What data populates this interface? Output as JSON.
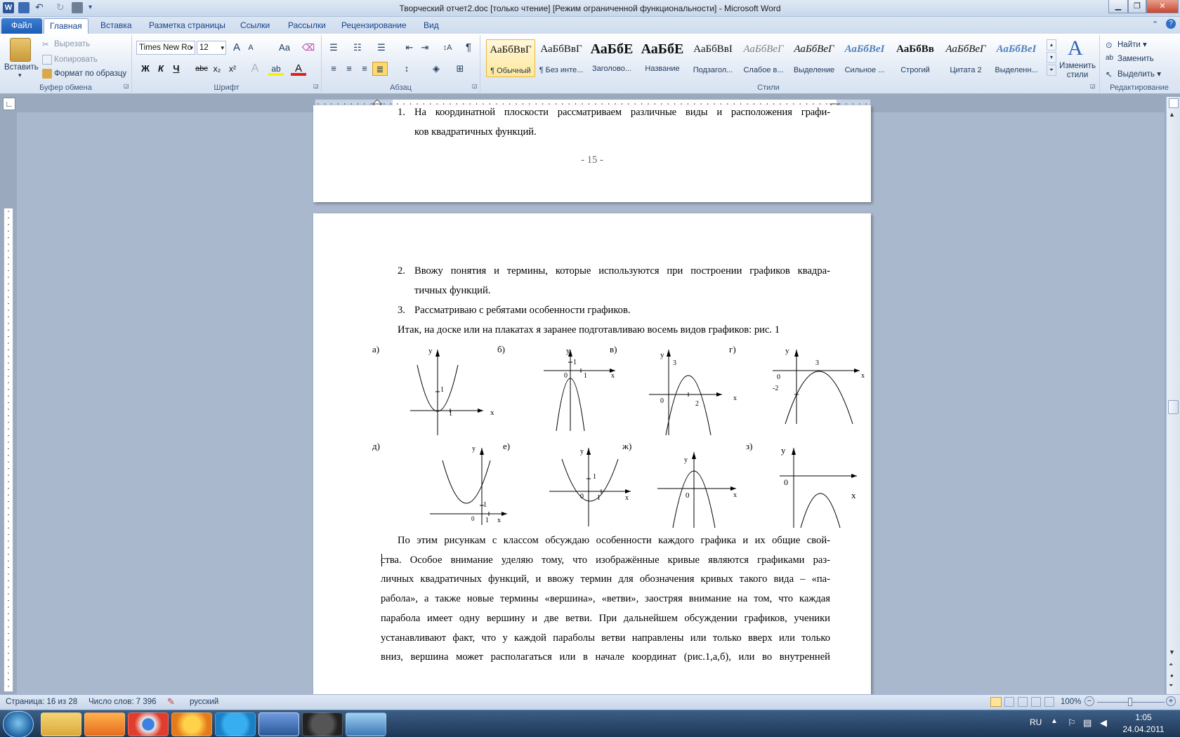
{
  "titlebar": {
    "title": "Творческий отчет2.doc [только чтение] [Режим ограниченной функциональности]  -  Microsoft Word"
  },
  "tabs": {
    "file": "Файл",
    "home": "Главная",
    "insert": "Вставка",
    "layout": "Разметка страницы",
    "refs": "Ссылки",
    "mail": "Рассылки",
    "review": "Рецензирование",
    "view": "Вид"
  },
  "clipboard": {
    "paste": "Вставить",
    "cut": "Вырезать",
    "copy": "Копировать",
    "format": "Формат по образцу",
    "label": "Буфер обмена"
  },
  "font": {
    "name": "Times New Rc",
    "size": "12",
    "label": "Шрифт",
    "bold": "Ж",
    "italic": "К",
    "underline": "Ч",
    "strike": "abc",
    "sub": "x₂",
    "sup": "x²",
    "grow": "A",
    "shrink": "A",
    "case": "Aa"
  },
  "paragraph": {
    "label": "Абзац",
    "pilcrow": "¶"
  },
  "styles": {
    "label": "Стили",
    "items": [
      {
        "sample": "АаБбВвГ",
        "name": "¶ Обычный"
      },
      {
        "sample": "АаБбВвГ",
        "name": "¶ Без инте..."
      },
      {
        "sample": "АаБбЕ",
        "name": "Заголово..."
      },
      {
        "sample": "АаБбЕ",
        "name": "Название"
      },
      {
        "sample": "АаБбВвІ",
        "name": "Подзагол..."
      },
      {
        "sample": "АаБбВеГ",
        "name": "Слабое в..."
      },
      {
        "sample": "АаБбВеГ",
        "name": "Выделение"
      },
      {
        "sample": "АаБбВеІ",
        "name": "Сильное ..."
      },
      {
        "sample": "АаБбВв",
        "name": "Строгий"
      },
      {
        "sample": "АаБбВеГ",
        "name": "Цитата 2"
      },
      {
        "sample": "АаБбВеІ",
        "name": "Выделенн..."
      }
    ],
    "change": "Изменить стили"
  },
  "editing": {
    "find": "Найти",
    "replace": "Заменить",
    "select": "Выделить",
    "label": "Редактирование"
  },
  "page1": {
    "item1_num": "1.",
    "item1_line1": "На координатной плоскости рассматриваем различные виды и расположения графи-",
    "item1_line2": "ков квадратичных функций.",
    "page_number": "- 15 -"
  },
  "page2": {
    "item2_num": "2.",
    "item2_line1": "Ввожу понятия и термины, которые используются при построении графиков квадра-",
    "item2_line2": "тичных функций.",
    "item3_num": "3.",
    "item3_line1": "Рассматриваю с ребятами особенности графиков.",
    "intro": "Итак,  на доске или на плакатах я заранее подготавливаю восемь видов графиков: рис. 1",
    "para_lines": [
      "По этим рисункам с классом обсуждаю особенности каждого графика и их общие свой-",
      "ства. Особое  внимание уделяю тому, что изображённые кривые являются графиками раз-",
      "личных квадратичных функций, и ввожу термин для обозначения кривых такого вида – «па-",
      "рабола», а также новые термины «вершина», «ветви», заостряя внимание на том, что каждая",
      "парабола имеет одну вершину и две ветви. При дальнейшем обсуждении графиков, ученики",
      "устанавливают факт, что у каждой параболы ветви направлены или только вверх или только",
      "вниз, вершина может располагаться или в начале координат (рис.1,а,б), или во внутренней"
    ]
  },
  "graphs": {
    "a": {
      "label": "а)",
      "y": "y",
      "x": "x",
      "t1": "1",
      "t2": "1"
    },
    "b": {
      "label": "б)",
      "y": "y",
      "x": "x",
      "t1": "1",
      "t0": "0",
      "t2": "1"
    },
    "v": {
      "label": "в)",
      "y": "y",
      "x": "x",
      "t3": "3",
      "t0": "0",
      "t2": "2"
    },
    "g": {
      "label": "г)",
      "y": "y",
      "x": "x",
      "t3": "3",
      "t0": "0",
      "tm2": "-2"
    },
    "d": {
      "label": "д)",
      "y": "y",
      "x": "x",
      "t1": "1",
      "t0": "0",
      "t2": "1"
    },
    "e": {
      "label": "е)",
      "y": "y",
      "x": "x",
      "t1": "1",
      "t0": "0",
      "t2": "1"
    },
    "zh": {
      "label": "ж)",
      "y": "y",
      "x": "x",
      "t0": "0"
    },
    "z": {
      "label": "з)",
      "y": "y",
      "x": "x",
      "t0": "0"
    }
  },
  "status": {
    "page": "Страница: 16 из 28",
    "words": "Число слов: 7 396",
    "lang": "русский",
    "zoom": "100%"
  },
  "taskbar": {
    "lang": "RU",
    "time": "1:05",
    "date": "24.04.2011"
  },
  "colors": {
    "accent": "#1d5eb7",
    "ribbon": "#dfe9f5"
  }
}
